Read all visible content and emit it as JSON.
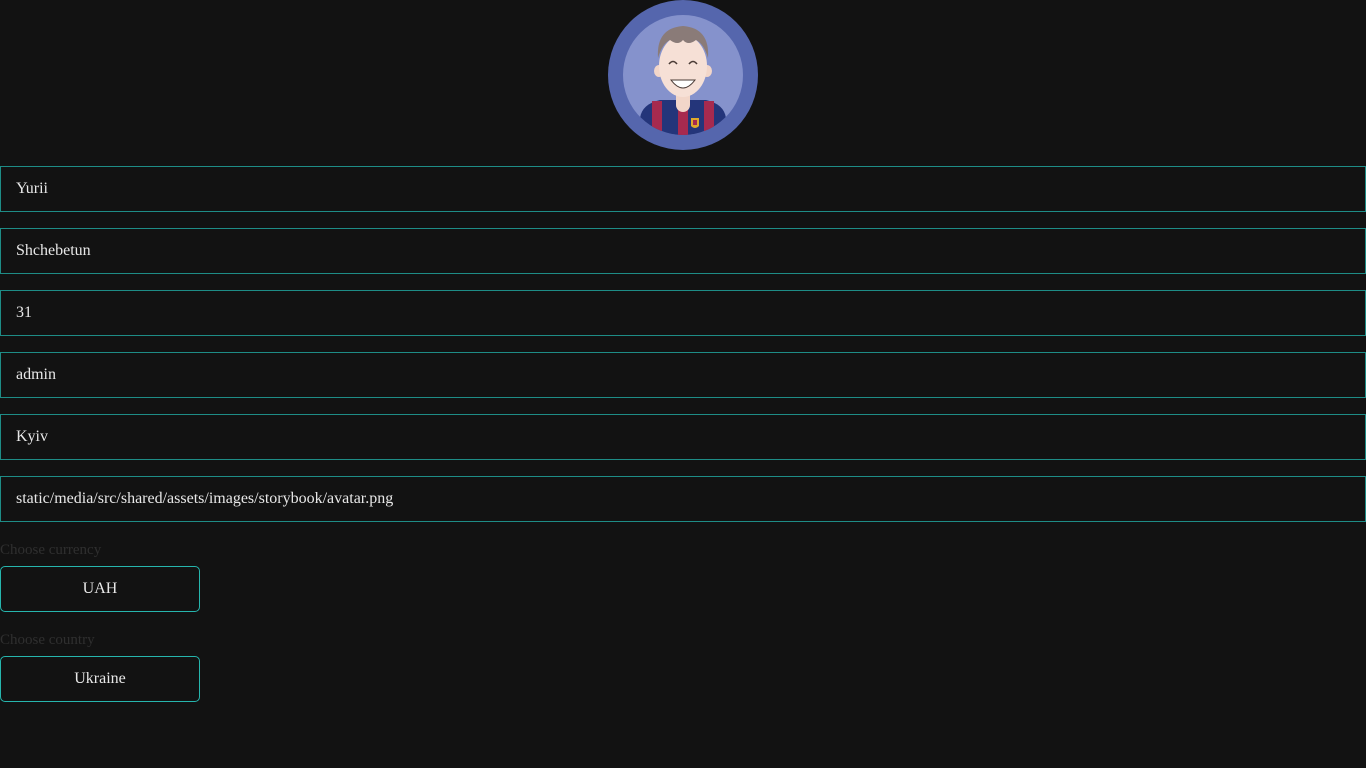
{
  "profile": {
    "avatar_icon": "user-avatar-image",
    "fields": {
      "first_name": "Yurii",
      "last_name": "Shchebetun",
      "age": "31",
      "username": "admin",
      "city": "Kyiv",
      "avatar_path": "static/media/src/shared/assets/images/storybook/avatar.png"
    },
    "currency": {
      "label": "Choose currency",
      "value": "UAH"
    },
    "country": {
      "label": "Choose country",
      "value": "Ukraine"
    }
  },
  "colors": {
    "background": "#121212",
    "input_border": "#1e8c86",
    "select_border": "#26b5ad",
    "label_text": "#2f2f2f",
    "text": "#e8e8e8"
  }
}
